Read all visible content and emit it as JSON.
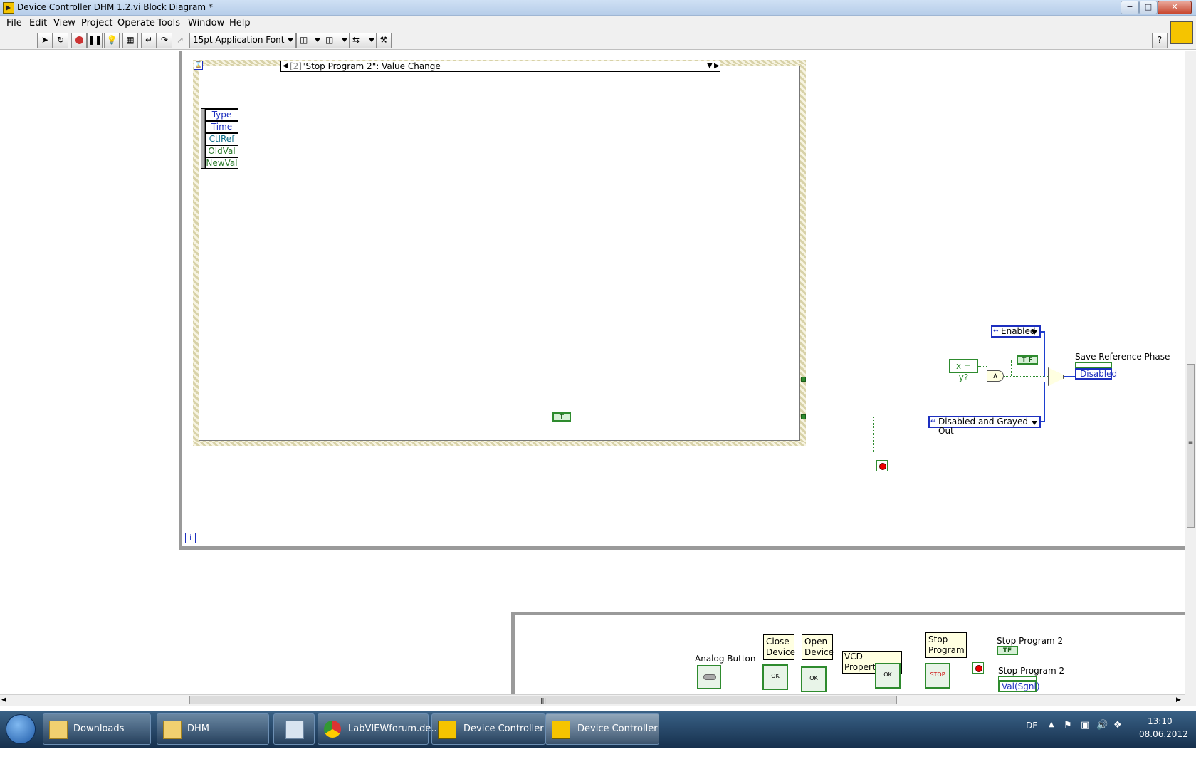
{
  "window": {
    "title": "Device Controller DHM 1.2.vi Block Diagram *",
    "min": "−",
    "max": "□",
    "close": "✕"
  },
  "menu": [
    "File",
    "Edit",
    "View",
    "Project",
    "Operate",
    "Tools",
    "Window",
    "Help"
  ],
  "toolbar": {
    "font": "15pt Application Font",
    "help": "?"
  },
  "event_structure": {
    "selector_index": "[2]",
    "selector_text": "\"Stop Program 2\": Value Change",
    "event_data": [
      "Type",
      "Time",
      "CtlRef",
      "OldVal",
      "NewVal"
    ]
  },
  "loop_index": "i",
  "diagram": {
    "bool_const_tf": "T F",
    "bool_const_true": "T",
    "compare": "x = y?",
    "and_symbol": "∧",
    "enum_enabled": "Enabled",
    "enum_disabled_grayed": "Disabled and Grayed Out",
    "save_ref_label": "Save Reference Phase",
    "save_ref_property": "Disabled"
  },
  "bottom_panel": {
    "analog_button": "Analog Button",
    "close_device": "Close\nDevice",
    "open_device": "Open\nDevice",
    "vcd_properties": "VCD Properties",
    "stop_program": "Stop\nProgram",
    "stop_program_2_a": "Stop Program 2",
    "stop_program_2_b": "Stop Program 2",
    "val_sgnl": "Val(Sgnl)",
    "ok": "OK",
    "stop": "STOP",
    "tf": "TF"
  },
  "scroll": {
    "hthumb_glyph": "|||",
    "vthumb_glyph": "≡"
  },
  "taskbar": {
    "items": [
      "Downloads",
      "DHM",
      "",
      "LabVIEWforum.de...",
      "Device Controller ...",
      "Device Controller ..."
    ],
    "lang": "DE",
    "time": "13:10",
    "date": "08.06.2012"
  }
}
